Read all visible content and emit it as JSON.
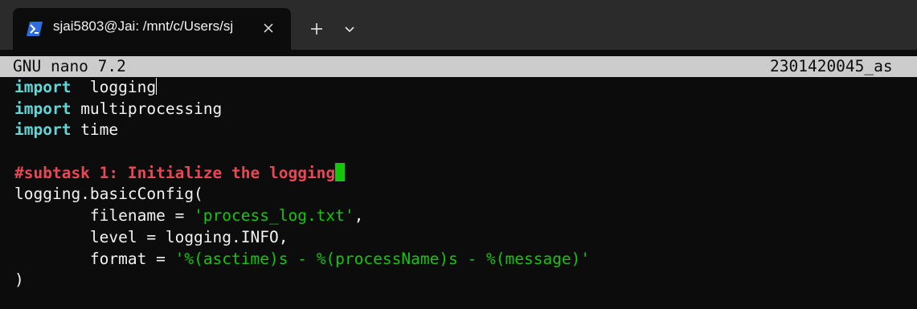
{
  "tab": {
    "title": "sjai5803@Jai: /mnt/c/Users/sj",
    "icon": "powershell-icon",
    "close_icon": "close-icon",
    "new_tab_icon": "plus-icon",
    "dropdown_icon": "chevron-down-icon"
  },
  "nano": {
    "version_label": "GNU nano 7.2",
    "filename": "2301420045_as"
  },
  "code": {
    "line1": {
      "keyword": "import",
      "rest": "  logging"
    },
    "line2": {
      "keyword": "import",
      "rest": " multiprocessing"
    },
    "line3": {
      "keyword": "import",
      "rest": " time"
    },
    "line5": {
      "comment": "#subtask 1: Initialize the logging"
    },
    "line6": {
      "text": "logging.basicConfig("
    },
    "line7": {
      "prefix": "        filename = ",
      "string": "'process_log.txt'",
      "suffix": ","
    },
    "line8": {
      "text": "        level = logging.INFO,"
    },
    "line9": {
      "prefix": "        format = ",
      "string": "'%(asctime)s - %(processName)s - %(message)'"
    },
    "line10": {
      "text": ")"
    }
  },
  "colors": {
    "terminal_background": "#0c0c0c",
    "tab_strip": "#2b2b2b",
    "titlebar": "#cccccc",
    "keyword": "#61d6d6",
    "string": "#16c60c",
    "comment": "#e74856",
    "cursor": "#16c60c"
  }
}
